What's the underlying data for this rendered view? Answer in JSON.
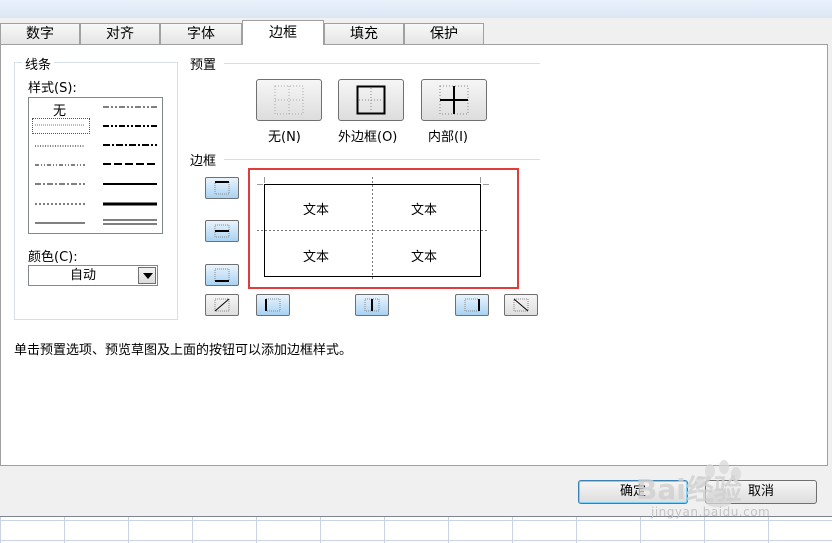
{
  "tabs": [
    "数字",
    "对齐",
    "字体",
    "边框",
    "填充",
    "保护"
  ],
  "active_tab": "边框",
  "line_group": {
    "title": "线条",
    "style_label": "样式(S):",
    "none_label": "无",
    "color_label": "颜色(C):",
    "color_value": "自动"
  },
  "presets": {
    "title": "预置",
    "none": "无(N)",
    "outline": "外边框(O)",
    "inside": "内部(I)"
  },
  "border": {
    "title": "边框",
    "cells": [
      "文本",
      "文本",
      "文本",
      "文本"
    ]
  },
  "hint": "单击预置选项、预览草图及上面的按钮可以添加边框样式。",
  "buttons": {
    "ok": "确定",
    "cancel": "取消"
  },
  "watermark": {
    "brand": "Bai经验",
    "url": "jingyan.baidu.com"
  },
  "colors": {
    "accent_red": "#e03c3c",
    "button_blue": "#a9d2f3"
  }
}
